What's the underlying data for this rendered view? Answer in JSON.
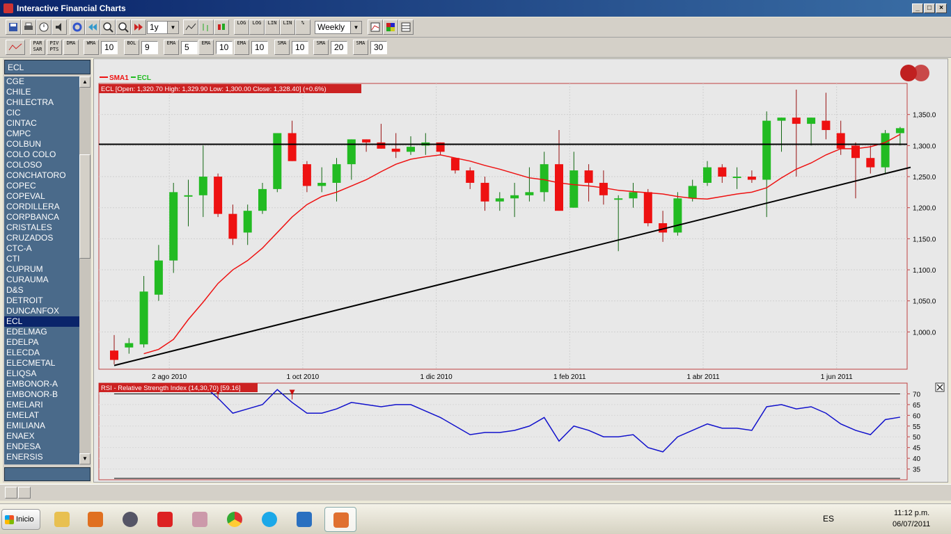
{
  "window": {
    "title": "Interactive Financial Charts"
  },
  "toolbar1": {
    "period": "1y",
    "interval": "Weekly",
    "log_label": "LOG",
    "lin_label": "LIN",
    "pct_label": "%"
  },
  "toolbar2": {
    "par_sar": "PAR SAR",
    "piv_pts": "PIV PTS",
    "dma": "DMA",
    "wma": "WMA",
    "wma_value": "10",
    "bol": "BOL",
    "bol_value": "9",
    "ema": "EMA",
    "ema1_value": "5",
    "ema2_value": "10",
    "ema3_value": "10",
    "sma": "SMA",
    "sma1_value": "10",
    "sma2_value": "20",
    "sma3_value": "30"
  },
  "sidebar": {
    "search_value": "ECL",
    "selected": "ECL",
    "items": [
      "CGE",
      "CHILE",
      "CHILECTRA",
      "CIC",
      "CINTAC",
      "CMPC",
      "COLBUN",
      "COLO COLO",
      "COLOSO",
      "CONCHATORO",
      "COPEC",
      "COPEVAL",
      "CORDILLERA",
      "CORPBANCA",
      "CRISTALES",
      "CRUZADOS",
      "CTC-A",
      "CTI",
      "CUPRUM",
      "CURAUMA",
      "D&S",
      "DETROIT",
      "DUNCANFOX",
      "ECL",
      "EDELMAG",
      "EDELPA",
      "ELECDA",
      "ELECMETAL",
      "ELIQSA",
      "EMBONOR-A",
      "EMBONOR-B",
      "EMELARI",
      "EMELAT",
      "EMILIANA",
      "ENAEX",
      "ENDESA",
      "ENERSIS"
    ]
  },
  "chart": {
    "legend_sma": "SMA1",
    "legend_ecl": "ECL",
    "ohlc_label": "ECL [Open: 1,320.70  High: 1,329.90  Low: 1,300.00  Close: 1,328.40] (+0.6%)",
    "up_color": "#22bb22",
    "down_color": "#ee1111",
    "sma_color": "#ee1111",
    "rsi_color": "#1111cc",
    "rsi_label": "RSI - Relative Strength Index (14,30,70) [59.16]"
  },
  "chart_data": [
    {
      "type": "candlestick",
      "series": [
        {
          "name": "ECL",
          "ohlc": [
            [
              970,
              995,
              948,
              955
            ],
            [
              975,
              990,
              965,
              982
            ],
            [
              980,
              1090,
              975,
              1065
            ],
            [
              1060,
              1140,
              1050,
              1115
            ],
            [
              1115,
              1240,
              1095,
              1225
            ],
            [
              1220,
              1245,
              1170,
              1220
            ],
            [
              1220,
              1300,
              1185,
              1250
            ],
            [
              1250,
              1255,
              1185,
              1190
            ],
            [
              1190,
              1205,
              1140,
              1150
            ],
            [
              1160,
              1205,
              1140,
              1195
            ],
            [
              1195,
              1240,
              1190,
              1230
            ],
            [
              1230,
              1320,
              1225,
              1320
            ],
            [
              1320,
              1340,
              1275,
              1275
            ],
            [
              1270,
              1275,
              1225,
              1235
            ],
            [
              1235,
              1265,
              1225,
              1240
            ],
            [
              1240,
              1280,
              1210,
              1270
            ],
            [
              1270,
              1310,
              1245,
              1310
            ],
            [
              1310,
              1310,
              1290,
              1305
            ],
            [
              1305,
              1335,
              1295,
              1295
            ],
            [
              1295,
              1320,
              1280,
              1290
            ],
            [
              1290,
              1315,
              1285,
              1298
            ],
            [
              1300,
              1320,
              1285,
              1305
            ],
            [
              1305,
              1305,
              1285,
              1290
            ],
            [
              1280,
              1280,
              1255,
              1260
            ],
            [
              1260,
              1265,
              1230,
              1240
            ],
            [
              1240,
              1250,
              1195,
              1210
            ],
            [
              1210,
              1225,
              1195,
              1215
            ],
            [
              1215,
              1240,
              1185,
              1220
            ],
            [
              1220,
              1265,
              1210,
              1225
            ],
            [
              1225,
              1290,
              1210,
              1270
            ],
            [
              1270,
              1325,
              1195,
              1195
            ],
            [
              1200,
              1290,
              1200,
              1260
            ],
            [
              1260,
              1270,
              1210,
              1240
            ],
            [
              1240,
              1260,
              1205,
              1220
            ],
            [
              1215,
              1220,
              1130,
              1215
            ],
            [
              1215,
              1240,
              1200,
              1225
            ],
            [
              1225,
              1230,
              1170,
              1175
            ],
            [
              1175,
              1195,
              1145,
              1160
            ],
            [
              1160,
              1225,
              1155,
              1215
            ],
            [
              1215,
              1245,
              1210,
              1235
            ],
            [
              1240,
              1275,
              1235,
              1265
            ],
            [
              1265,
              1270,
              1240,
              1250
            ],
            [
              1250,
              1265,
              1230,
              1250
            ],
            [
              1250,
              1260,
              1240,
              1245
            ],
            [
              1245,
              1355,
              1185,
              1340
            ],
            [
              1340,
              1345,
              1290,
              1345
            ],
            [
              1345,
              1390,
              1250,
              1335
            ],
            [
              1335,
              1345,
              1300,
              1345
            ],
            [
              1340,
              1385,
              1310,
              1325
            ],
            [
              1320,
              1340,
              1285,
              1295
            ],
            [
              1300,
              1305,
              1215,
              1280
            ],
            [
              1280,
              1300,
              1255,
              1265
            ],
            [
              1265,
              1325,
              1255,
              1320
            ],
            [
              1320,
              1330,
              1300,
              1328
            ]
          ]
        },
        {
          "name": "SMA1",
          "values": [
            null,
            null,
            965,
            972,
            988,
            1020,
            1048,
            1078,
            1100,
            1115,
            1135,
            1160,
            1185,
            1205,
            1218,
            1225,
            1235,
            1245,
            1258,
            1270,
            1278,
            1282,
            1285,
            1280,
            1275,
            1268,
            1262,
            1255,
            1248,
            1245,
            1240,
            1237,
            1235,
            1232,
            1228,
            1226,
            1224,
            1222,
            1218,
            1215,
            1214,
            1218,
            1222,
            1225,
            1232,
            1248,
            1262,
            1272,
            1285,
            1295,
            1295,
            1298,
            1305,
            1318
          ]
        }
      ],
      "x_tick_labels": [
        "2 ago 2010",
        "1 oct 2010",
        "1 dic 2010",
        "1 feb 2011",
        "1 abr 2011",
        "1 jun 2011"
      ],
      "y_tick_labels": [
        "1,000.0",
        "1,050.0",
        "1,100.0",
        "1,150.0",
        "1,200.0",
        "1,250.0",
        "1,300.0",
        "1,350.0"
      ],
      "ylim": [
        940,
        1400
      ]
    },
    {
      "type": "line",
      "series": [
        {
          "name": "RSI",
          "values": [
            null,
            null,
            null,
            null,
            null,
            72,
            74,
            68,
            61,
            63,
            65,
            72,
            66,
            61,
            61,
            63,
            66,
            65,
            64,
            65,
            65,
            62,
            59,
            55,
            51,
            52,
            52,
            53,
            55,
            59,
            48,
            55,
            53,
            50,
            50,
            51,
            45,
            43,
            50,
            53,
            56,
            54,
            54,
            53,
            64,
            65,
            63,
            64,
            61,
            56,
            53,
            51,
            58,
            59.16
          ]
        }
      ],
      "y_tick_labels": [
        "35",
        "40",
        "45",
        "50",
        "55",
        "60",
        "65",
        "70"
      ],
      "ylim": [
        30,
        75
      ]
    }
  ]
}
